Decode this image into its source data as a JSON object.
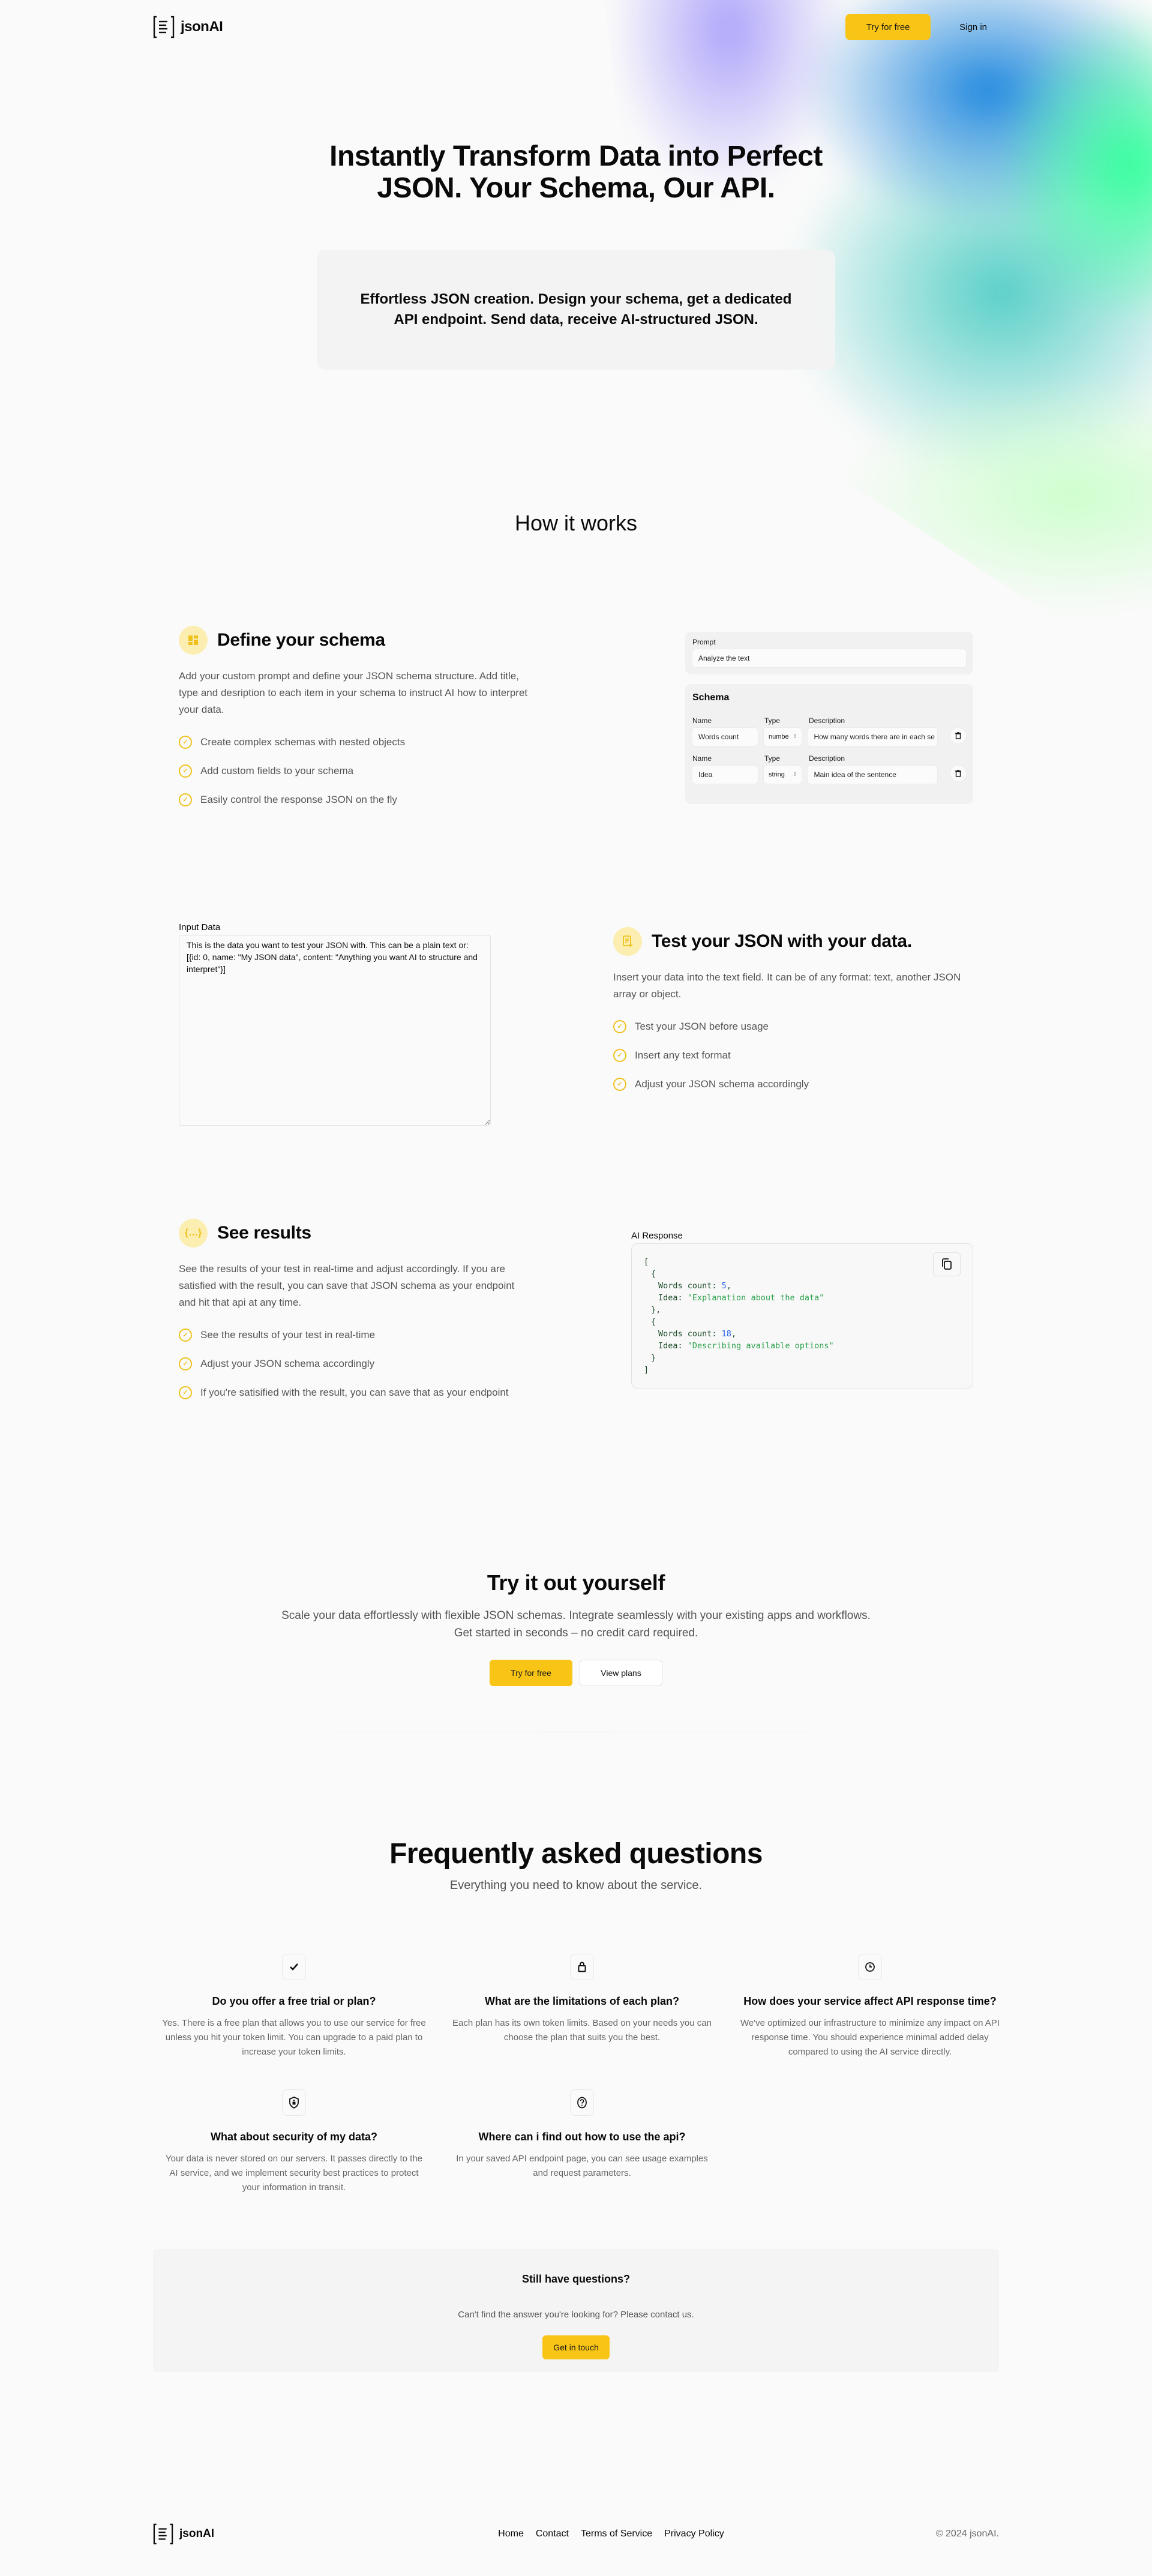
{
  "brand": {
    "name": "jsonAI",
    "accent": "#f8c516",
    "icon_accent": "#f0c11d"
  },
  "header": {
    "try_label": "Try for free",
    "signin_label": "Sign in"
  },
  "hero": {
    "title": "Instantly Transform Data into Perfect JSON. Your Schema, Our API.",
    "subtitle": "Effortless JSON creation. Design your schema, get a dedicated API endpoint. Send data, receive AI-structured JSON."
  },
  "how": {
    "title": "How it works",
    "steps": [
      {
        "icon": "layout-grid-icon",
        "title": "Define your schema",
        "desc": "Add your custom prompt and define your JSON schema structure. Add title, type and desription to each item in your schema to instruct AI how to interpret your data.",
        "bullets": [
          "Create complex schemas with nested objects",
          "Add custom fields to your schema",
          "Easily control the response JSON on the fly"
        ]
      },
      {
        "icon": "file-plus-icon",
        "title": "Test your JSON with your data.",
        "desc": "Insert your data into the text field. It can be of any format: text, another JSON array or object.",
        "bullets": [
          "Test your JSON before usage",
          "Insert any text format",
          "Adjust your JSON schema accordingly"
        ]
      },
      {
        "icon": "braces-icon",
        "title": "See results",
        "desc": "See the results of your test in real-time and adjust accordingly. If you are satisfied with the result, you can save that JSON schema as your endpoint and hit that api at any time.",
        "bullets": [
          "See the results of your test in real-time",
          "Adjust your JSON schema accordingly",
          "If you're satisified with the result, you can save that as your endpoint"
        ]
      }
    ]
  },
  "schema_mock": {
    "prompt_label": "Prompt",
    "prompt_value": "Analyze the text",
    "schema_title": "Schema",
    "col_name": "Name",
    "col_type": "Type",
    "col_desc": "Description",
    "rows": [
      {
        "name": "Words count",
        "type": "numbe",
        "desc": "How many words there are in each se"
      },
      {
        "name": "Idea",
        "type": "string",
        "desc": "Main idea of the sentence"
      }
    ]
  },
  "input_data": {
    "label": "Input Data",
    "value": "This is the data you want to test your JSON with. This can be a plain text or: [{id: 0, name: \"My JSON data\", content: \"Anything you want AI to structure and interpret\"}]"
  },
  "ai_response": {
    "label": "AI Response",
    "items": [
      {
        "key1": "Words count",
        "val1": "5",
        "key2": "Idea",
        "val2": "\"Explanation about the data\""
      },
      {
        "key1": "Words count",
        "val1": "18",
        "key2": "Idea",
        "val2": "\"Describing available options\""
      }
    ]
  },
  "cta": {
    "title": "Try it out yourself",
    "desc": "Scale your data effortlessly with flexible JSON schemas. Integrate seamlessly with your existing apps and workflows. Get started in seconds – no credit card required.",
    "primary": "Try for free",
    "secondary": "View plans"
  },
  "faq": {
    "title": "Frequently asked questions",
    "subtitle": "Everything you need to know about the service.",
    "items": [
      {
        "icon": "checkmark-icon",
        "q": "Do you offer a free trial or plan?",
        "a": "Yes. There is a free plan that allows you to use our service for free unless you hit your token limit. You can upgrade to a paid plan to increase your token limits."
      },
      {
        "icon": "lock-icon",
        "q": "What are the limitations of each plan?",
        "a": "Each plan has its own token limits. Based on your needs you can choose the plan that suits you the best."
      },
      {
        "icon": "clock-icon",
        "q": "How does your service affect API response time?",
        "a": "We've optimized our infrastructure to minimize any impact on API response time. You should experience minimal added delay compared to using the AI service directly."
      },
      {
        "icon": "shield-lock-icon",
        "q": "What about security of my data?",
        "a": "Your data is never stored on our servers. It passes directly to the AI service, and we implement security best practices to protect your information in transit."
      },
      {
        "icon": "question-circle-icon",
        "q": "Where can i find out how to use the api?",
        "a": "In your saved API endpoint page, you can see usage examples and request parameters."
      }
    ],
    "still_title": "Still have questions?",
    "still_desc": "Can't find the answer you're looking for? Please contact us.",
    "still_btn": "Get in touch"
  },
  "footer": {
    "links": [
      "Home",
      "Contact",
      "Terms of Service",
      "Privacy Policy"
    ],
    "copyright": "© 2024 jsonAI."
  }
}
